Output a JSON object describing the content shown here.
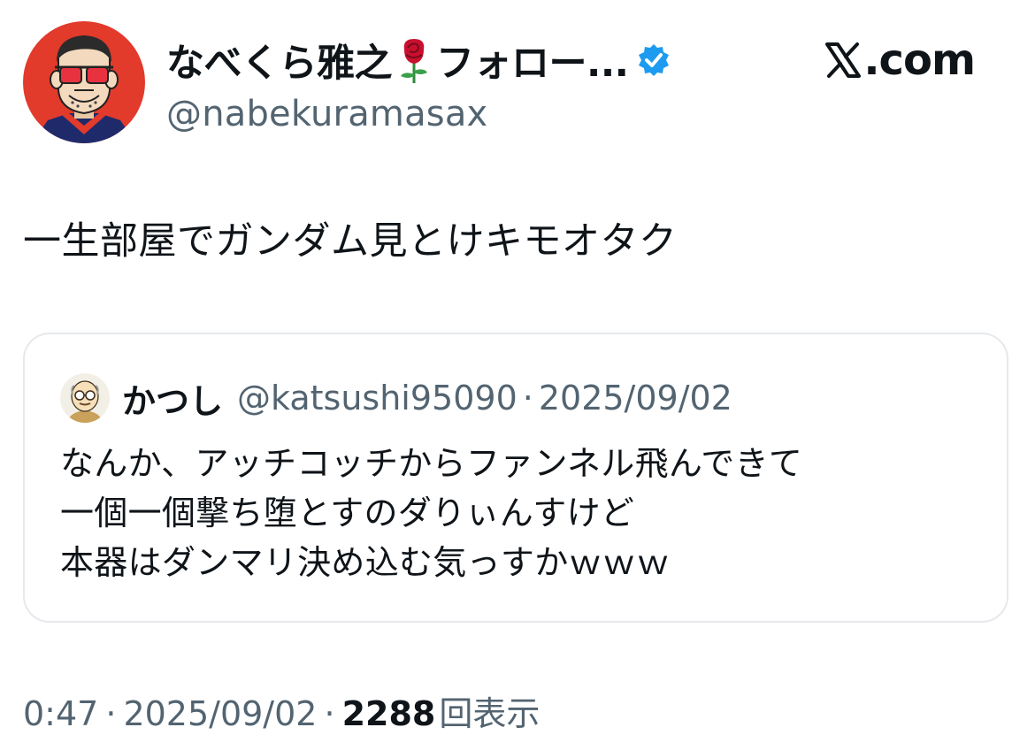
{
  "post": {
    "author": {
      "name": "なべくら雅之",
      "name_suffix": "フォロー...",
      "handle": "@nabekuramasax",
      "verified": true,
      "avatar_icon": "cartoon-man-sunglasses-avatar"
    },
    "brand": {
      "logo_icon": "x-logo-icon",
      "domain": ".com"
    },
    "text": "一生部屋でガンダム見とけキモオタク",
    "quote": {
      "author_name": "かつし",
      "author_handle": "@katsushi95090",
      "separator": "·",
      "date": "2025/09/02",
      "avatar_icon": "bald-old-man-avatar",
      "lines": [
        "なんか、アッチコッチからファンネル飛んできて",
        "一個一個撃ち堕とすのダりぃんすけど",
        "本器はダンマリ決め込む気っすかｗｗｗ"
      ]
    },
    "meta": {
      "time": "0:47",
      "separator": "·",
      "date": "2025/09/02",
      "views_count": "2288",
      "views_label": "回表示"
    }
  },
  "colors": {
    "text_primary": "#0f1419",
    "text_secondary": "#536471",
    "verified_blue": "#1d9bf0",
    "card_border": "#e6e9ec",
    "avatar_red": "#e23a2b"
  }
}
